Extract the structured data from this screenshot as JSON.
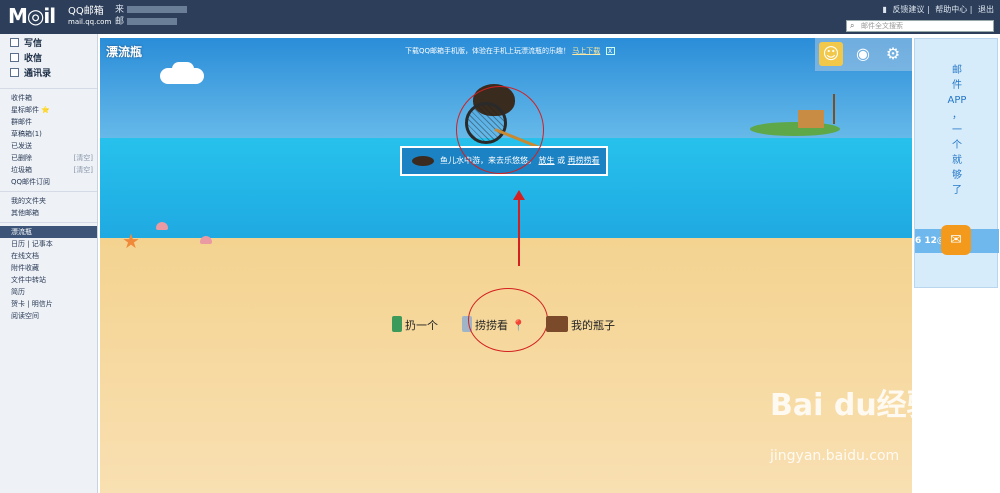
{
  "header": {
    "logo": "M◎il",
    "logo_name": "QQ邮箱",
    "logo_domain": "mail.qq.com",
    "user_line1": "来",
    "user_line2": "邮",
    "links": [
      "反馈建议",
      "帮助中心",
      "退出"
    ],
    "search_placeholder": "邮件全文搜索"
  },
  "sidebar": {
    "main": [
      "写信",
      "收信",
      "通讯录"
    ],
    "folders": [
      {
        "label": "收件箱",
        "right": ""
      },
      {
        "label": "星标邮件 ⭐",
        "right": ""
      },
      {
        "label": "群邮件",
        "right": ""
      },
      {
        "label": "草稿箱(1)",
        "right": ""
      },
      {
        "label": "已发送",
        "right": ""
      },
      {
        "label": "已删除",
        "right": "[清空]"
      },
      {
        "label": "垃圾箱",
        "right": "[清空]"
      },
      {
        "label": "QQ邮件订阅",
        "right": ""
      }
    ],
    "my_folders": [
      "我的文件夹",
      "其他邮箱"
    ],
    "apps": [
      "漂流瓶",
      "日历 | 记事本",
      "在线文档",
      "附件收藏",
      "文件中转站",
      "简历",
      "贺卡 | 明信片",
      "阅读空间"
    ]
  },
  "scene": {
    "title": "漂流瓶",
    "banner": "下载QQ邮箱手机版，体验在手机上玩漂流瓶的乐趣！",
    "banner_link": "马上下载",
    "banner_close": "X",
    "message_prefix": "鱼儿水中游，来去乐悠悠。",
    "message_link1": "放生",
    "message_or": "或",
    "message_link2": "再捞捞看",
    "actions": [
      "扔一个",
      "捞捞看",
      "我的瓶子"
    ],
    "badges": [
      "0",
      "0"
    ]
  },
  "ad": {
    "text": [
      "邮",
      "件",
      "APP",
      "，",
      "一",
      "个",
      "就",
      "够",
      "了"
    ],
    "strip": "6 12◎ ⛓"
  },
  "watermark": {
    "main": "Bai  du经验",
    "sub": "jingyan.baidu.com"
  },
  "colors": {
    "header_bg": "#2c3e5a",
    "sky": "#2a8dd8",
    "sea": "#1ea6e0",
    "sand": "#f4d390",
    "annotation": "#d42020"
  }
}
